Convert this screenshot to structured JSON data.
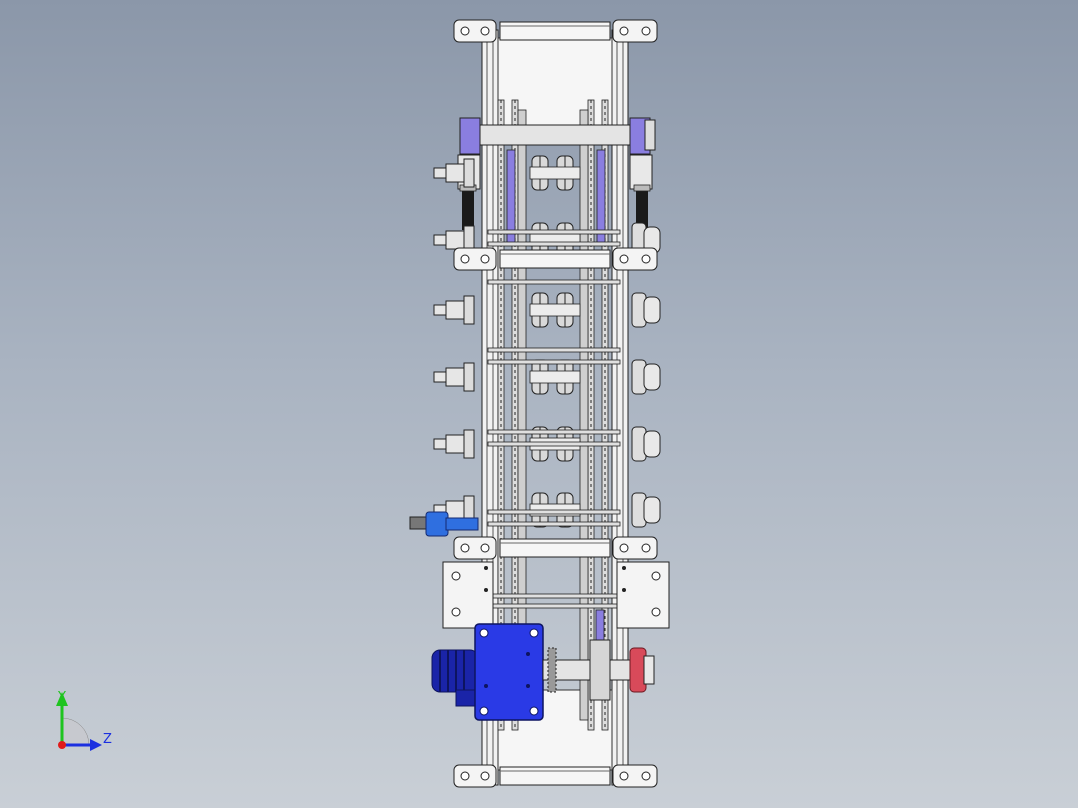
{
  "triad": {
    "y_label": "Y",
    "z_label": "Z",
    "colors": {
      "y": "#1fc41f",
      "z": "#1b2fe0",
      "x": "#e01b1b"
    }
  },
  "model": {
    "colors": {
      "frame": "#f4f4f4",
      "steel": "#c8c8c8",
      "dark": "#1a1a1a",
      "chain": "#8a8a8a",
      "accent_purple": "#8a7ee0",
      "motor_blue": "#2a3ae6",
      "motor_dark_blue": "#1a24a8",
      "tensioner_red": "#d84a5a",
      "cylinder_blue": "#2f6fe0"
    }
  }
}
